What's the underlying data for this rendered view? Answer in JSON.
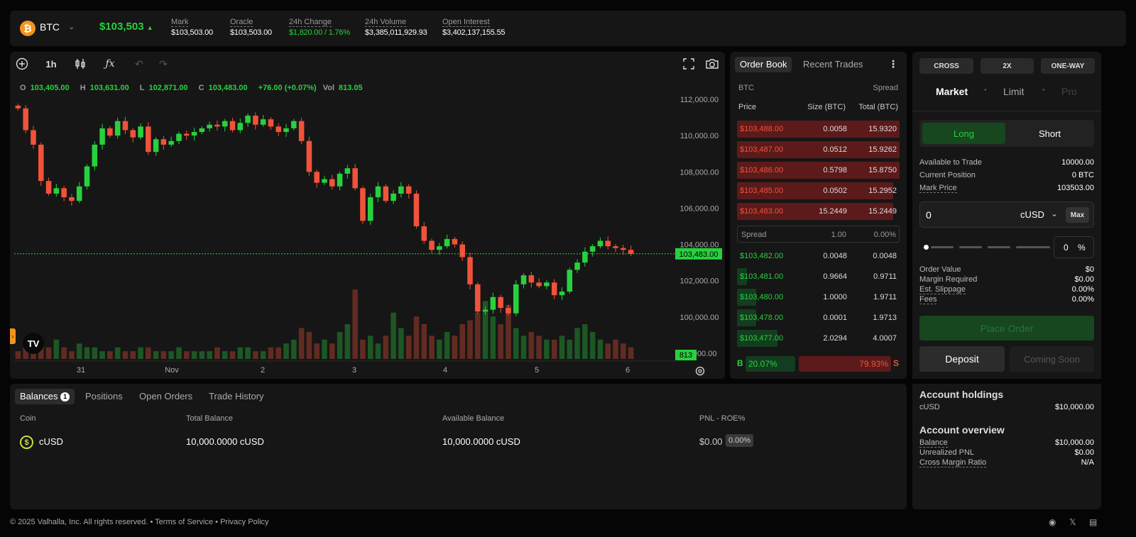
{
  "header": {
    "symbol": "BTC",
    "price": "$103,503",
    "stats": [
      {
        "label": "Mark",
        "value": "$103,503.00"
      },
      {
        "label": "Oracle",
        "value": "$103,503.00"
      },
      {
        "label": "24h Change",
        "value": "$1,820.00 / 1.76%"
      },
      {
        "label": "24h Volume",
        "value": "$3,385,011,929.93"
      },
      {
        "label": "Open Interest",
        "value": "$3,402,137,155.55"
      }
    ]
  },
  "chart_toolbar": {
    "interval": "1h"
  },
  "ohlc": {
    "o_label": "O",
    "o": "103,405.00",
    "h_label": "H",
    "h": "103,631.00",
    "l_label": "L",
    "l": "102,871.00",
    "c_label": "C",
    "c": "103,483.00",
    "change": "+76.00 (+0.07%)",
    "vol_label": "Vol",
    "vol": "813.05"
  },
  "chart_data": {
    "type": "candlestick",
    "y_ticks": [
      "112,000.00",
      "110,000.00",
      "108,000.00",
      "106,000.00",
      "104,000.00",
      "102,000.00",
      "100,000.00",
      "98,000.00"
    ],
    "ylim": [
      98000,
      112000
    ],
    "x_ticks": [
      "31",
      "Nov",
      "2",
      "3",
      "4",
      "5",
      "6"
    ],
    "last_price_label": "103,483.00",
    "last_volume_label": "813",
    "colors": {
      "up": "#27d13e",
      "down": "#f0533a"
    },
    "close_path": [
      111500,
      110300,
      109500,
      107500,
      106800,
      107100,
      106600,
      106400,
      107200,
      108300,
      109500,
      110400,
      110000,
      110800,
      110300,
      109900,
      110500,
      109100,
      109800,
      109500,
      109700,
      110100,
      110000,
      110200,
      110400,
      110600,
      110500,
      110800,
      110300,
      110700,
      111100,
      110600,
      110900,
      110500,
      110200,
      110400,
      110800,
      109700,
      108000,
      107400,
      107600,
      107200,
      107900,
      108200,
      107100,
      105300,
      106600,
      107200,
      106400,
      106800,
      107200,
      106800,
      105000,
      104200,
      103700,
      103900,
      104300,
      104000,
      103300,
      101800,
      100300,
      100400,
      101100,
      100500,
      100200,
      101800,
      102300,
      101900,
      101700,
      101900,
      101200,
      101400,
      102600,
      103000,
      103600,
      103900,
      104200,
      103900,
      103800,
      103700,
      103483
    ],
    "volumes": [
      2,
      3,
      2,
      4,
      3,
      5,
      3,
      2,
      4,
      3,
      3,
      2,
      2,
      3,
      2,
      2,
      3,
      3,
      2,
      2,
      2,
      3,
      2,
      2,
      2,
      2,
      3,
      2,
      2,
      3,
      3,
      2,
      2,
      3,
      3,
      4,
      5,
      8,
      7,
      4,
      5,
      4,
      7,
      9,
      18,
      5,
      6,
      4,
      6,
      12,
      8,
      6,
      11,
      9,
      6,
      5,
      7,
      6,
      9,
      10,
      12,
      15,
      11,
      9,
      14,
      8,
      6,
      7,
      6,
      5,
      5,
      6,
      5,
      8,
      9,
      7,
      5,
      4,
      5,
      4,
      3
    ]
  },
  "orderbook": {
    "tabs": [
      "Order Book",
      "Recent Trades"
    ],
    "asset": "BTC",
    "spread_header": "Spread",
    "columns": [
      "Price",
      "Size (BTC)",
      "Total (BTC)"
    ],
    "asks": [
      {
        "price": "$103,488.00",
        "size": "0.0058",
        "total": "15.9320",
        "depth": 1.0
      },
      {
        "price": "$103,487.00",
        "size": "0.0512",
        "total": "15.9262",
        "depth": 1.0
      },
      {
        "price": "$103,486.00",
        "size": "0.5798",
        "total": "15.8750",
        "depth": 1.0
      },
      {
        "price": "$103,485.00",
        "size": "0.0502",
        "total": "15.2952",
        "depth": 0.96
      },
      {
        "price": "$103,483.00",
        "size": "15.2449",
        "total": "15.2449",
        "depth": 0.96
      }
    ],
    "spread": {
      "label": "Spread",
      "value": "1.00",
      "pct": "0.00%"
    },
    "bids": [
      {
        "price": "$103,482.00",
        "size": "0.0048",
        "total": "0.0048",
        "depth": 0.0
      },
      {
        "price": "$103,481.00",
        "size": "0.9664",
        "total": "0.9711",
        "depth": 0.06
      },
      {
        "price": "$103,480.00",
        "size": "1.0000",
        "total": "1.9711",
        "depth": 0.12
      },
      {
        "price": "$103,478.00",
        "size": "0.0001",
        "total": "1.9713",
        "depth": 0.12
      },
      {
        "price": "$103,477.00",
        "size": "2.0294",
        "total": "4.0007",
        "depth": 0.25
      }
    ],
    "buy_label": "B",
    "buy_pct": "20.07%",
    "sell_label": "S",
    "sell_pct": "79.93%"
  },
  "order": {
    "margin_mode": "CROSS",
    "leverage": "2X",
    "position_mode": "ONE-WAY",
    "types": [
      "Market",
      "Limit",
      "Pro"
    ],
    "long": "Long",
    "short": "Short",
    "available_label": "Available to Trade",
    "available": "10000.00",
    "position_label": "Current Position",
    "position": "0 BTC",
    "mark_label": "Mark Price",
    "mark": "103503.00",
    "amount": "0",
    "currency": "cUSD",
    "max": "Max",
    "slider_pct": "0",
    "pct_sign": "%",
    "order_value_label": "Order Value",
    "order_value": "$0",
    "margin_label": "Margin Required",
    "margin": "$0.00",
    "slippage_label": "Est. Slippage",
    "slippage": "0.00%",
    "fees_label": "Fees",
    "fees": "0.00%",
    "place": "Place Order",
    "deposit": "Deposit",
    "coming_soon": "Coming Soon",
    "holdings_title": "Account holdings",
    "holdings_coin": "cUSD",
    "holdings_value": "$10,000.00",
    "overview_title": "Account overview",
    "balance_label": "Balance",
    "balance": "$10,000.00",
    "upnl_label": "Unrealized PNL",
    "upnl": "$0.00",
    "cmr_label": "Cross Margin Ratio",
    "cmr": "N/A"
  },
  "balances": {
    "tabs": [
      "Balances",
      "Positions",
      "Open Orders",
      "Trade History"
    ],
    "badge": "1",
    "columns": [
      "Coin",
      "Total Balance",
      "Available Balance",
      "PNL - ROE%"
    ],
    "row": {
      "coin": "cUSD",
      "total": "10,000.0000 cUSD",
      "available": "10,000.0000 cUSD",
      "pnl": "$0.00",
      "roe": "0.00%"
    }
  },
  "footer": {
    "copyright": "© 2025 Valhalla, Inc. All rights reserved.",
    "sep": "•",
    "terms": "Terms of Service",
    "privacy": "Privacy Policy"
  }
}
